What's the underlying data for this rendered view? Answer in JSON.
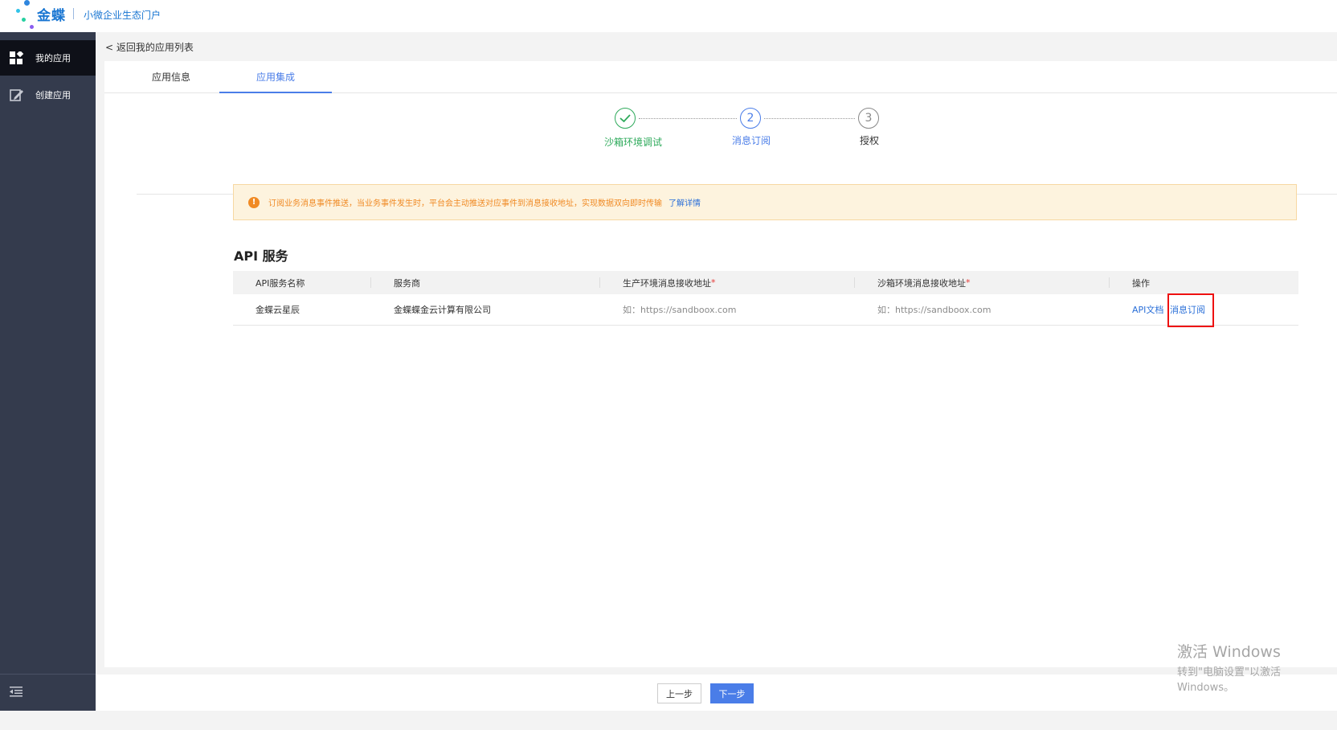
{
  "brand": {
    "name": "金蝶",
    "subtitle": "小微企业生态门户"
  },
  "sidebar": {
    "items": [
      {
        "label": "我的应用",
        "icon": "apps-grid-icon",
        "active": true
      },
      {
        "label": "创建应用",
        "icon": "edit-icon",
        "active": false
      }
    ],
    "collapse_icon": "collapse-menu-icon"
  },
  "main": {
    "back_link": "< 返回我的应用列表",
    "tabs": [
      {
        "label": "应用信息",
        "active": false
      },
      {
        "label": "应用集成",
        "active": true
      }
    ],
    "steps": [
      {
        "number": "✓",
        "label": "沙箱环境调试",
        "state": "done"
      },
      {
        "number": "2",
        "label": "消息订阅",
        "state": "current"
      },
      {
        "number": "3",
        "label": "授权",
        "state": "pending"
      }
    ],
    "alert": {
      "text": "订阅业务消息事件推送，当业务事件发生时，平台会主动推送对应事件到消息接收地址，实现数据双向即时传输",
      "link": "了解详情"
    },
    "section_title": "API 服务",
    "table": {
      "headers": [
        "API服务名称",
        "服务商",
        "生产环境消息接收地址",
        "沙箱环境消息接收地址",
        "操作"
      ],
      "required_mark": "*",
      "rows": [
        {
          "name": "金蝶云星辰",
          "provider": "金蝶蝶金云计算有限公司",
          "prod_placeholder": "如：https://sandboox.com",
          "sandbox_placeholder": "如：https://sandboox.com",
          "actions": [
            "API文档",
            "消息订阅"
          ]
        }
      ]
    }
  },
  "footer": {
    "prev_label": "上一步",
    "next_label": "下一步"
  },
  "watermark": {
    "line1": "激活 Windows",
    "line2": "转到\"电脑设置\"以激活 Windows。"
  },
  "colors": {
    "accent": "#4a7de8",
    "success": "#2eaa5b",
    "sidebar": "#343b4d",
    "warning": "#f08a24"
  }
}
